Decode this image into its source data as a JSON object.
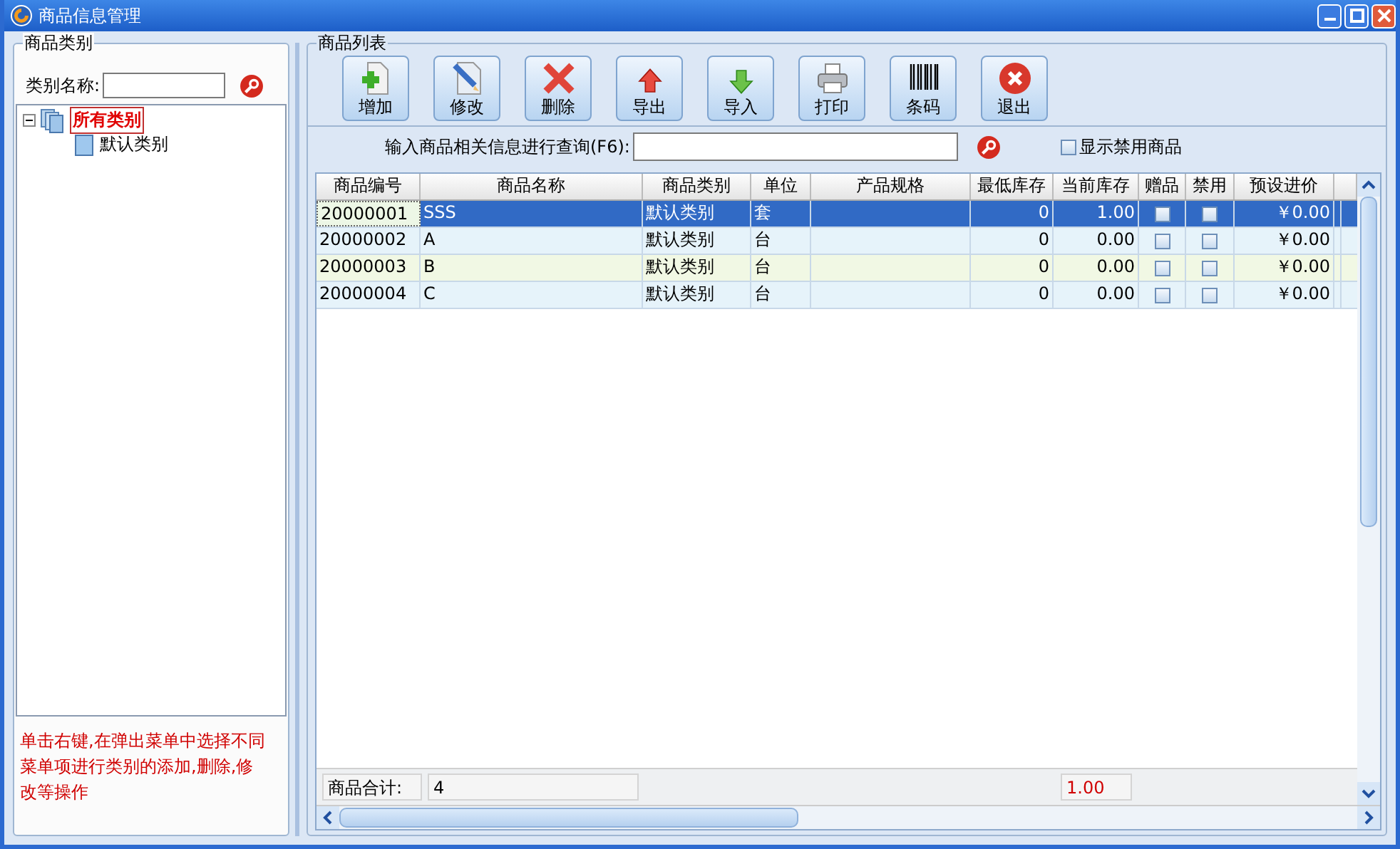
{
  "window": {
    "title": "商品信息管理"
  },
  "category_panel": {
    "title": "商品类别",
    "search_label": "类别名称:",
    "tree": [
      {
        "label": "所有类别",
        "selected": true,
        "expanded": true,
        "children": [
          {
            "label": "默认类别",
            "selected": false
          }
        ]
      }
    ],
    "hint": "单击右键,在弹出菜单中选择不同菜单项进行类别的添加,删除,修改等操作"
  },
  "product_panel": {
    "title": "商品列表",
    "toolbar": [
      {
        "kind": "add",
        "label": "增加"
      },
      {
        "kind": "edit",
        "label": "修改"
      },
      {
        "kind": "delete",
        "label": "删除"
      },
      {
        "kind": "export",
        "label": "导出"
      },
      {
        "kind": "import",
        "label": "导入"
      },
      {
        "kind": "print",
        "label": "打印"
      },
      {
        "kind": "barcode",
        "label": "条码"
      },
      {
        "kind": "exit",
        "label": "退出"
      }
    ],
    "search_label": "输入商品相关信息进行查询(F6):",
    "show_disabled": {
      "label": "显示禁用商品",
      "checked": false
    },
    "table": {
      "columns": [
        "商品编号",
        "商品名称",
        "商品类别",
        "单位",
        "产品规格",
        "最低库存",
        "当前库存",
        "赠品",
        "禁用",
        "预设进价"
      ],
      "rows": [
        {
          "code": "20000001",
          "name": "SSS",
          "category": "默认类别",
          "unit": "套",
          "spec": "",
          "min_stock": "0",
          "stock": "1.00",
          "gift": false,
          "disabled": false,
          "price": "￥0.00",
          "selected": true
        },
        {
          "code": "20000002",
          "name": "A",
          "category": "默认类别",
          "unit": "台",
          "spec": "",
          "min_stock": "0",
          "stock": "0.00",
          "gift": false,
          "disabled": false,
          "price": "￥0.00",
          "selected": false
        },
        {
          "code": "20000003",
          "name": "B",
          "category": "默认类别",
          "unit": "台",
          "spec": "",
          "min_stock": "0",
          "stock": "0.00",
          "gift": false,
          "disabled": false,
          "price": "￥0.00",
          "selected": false
        },
        {
          "code": "20000004",
          "name": "C",
          "category": "默认类别",
          "unit": "台",
          "spec": "",
          "min_stock": "0",
          "stock": "0.00",
          "gift": false,
          "disabled": false,
          "price": "￥0.00",
          "selected": false
        }
      ],
      "summary": {
        "label": "商品合计:",
        "count": "4",
        "stock_total": "1.00"
      }
    }
  }
}
